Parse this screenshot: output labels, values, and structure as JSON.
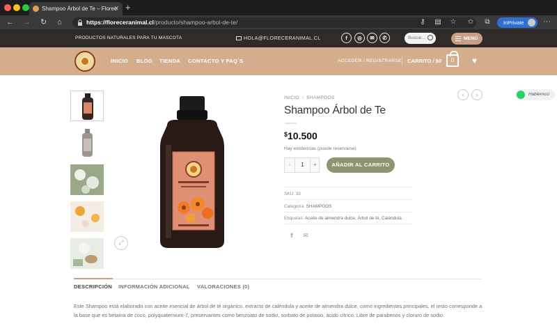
{
  "browser": {
    "tab_title": "Shampoo Árbol de Te – Florec",
    "tab_close": "✕",
    "new_tab": "+",
    "url_host": "https://floreceranimal.cl",
    "url_path": "/producto/shampoo-arbol-de-te/",
    "inprivate_label": "InPrivate",
    "traffic_lights": [
      "#ff5f57",
      "#febc2e",
      "#28c840"
    ]
  },
  "topbar": {
    "tagline": "PRODUCTOS NATURALES PARA TU MASCOTA",
    "email": "HOLA@FLORECERANIMAL.CL",
    "search_placeholder": "Buscar...",
    "menu_label": "MENÚ",
    "social": [
      {
        "name": "facebook-icon",
        "glyph": "f"
      },
      {
        "name": "instagram-icon",
        "glyph": "◎"
      },
      {
        "name": "mail-icon",
        "glyph": "✉"
      },
      {
        "name": "phone-icon",
        "glyph": "✆"
      }
    ]
  },
  "header": {
    "nav": [
      "INICIO",
      "BLOG",
      "TIENDA",
      "CONTACTO Y FAQ´S"
    ],
    "login": "ACCEDER / REGISTRARSE",
    "cart_label": "CARRITO / $0",
    "cart_count": "0"
  },
  "product": {
    "breadcrumb": [
      "INICIO",
      "SHAMPOOS"
    ],
    "title": "Shampoo Árbol de Te",
    "price_symbol": "$",
    "price": "10.500",
    "stock": "Hay existencias (puede reservarse)",
    "quantity": "1",
    "add_to_cart": "AÑADIR AL CARRITO",
    "sku_label": "SKU:",
    "sku": "33",
    "category_label": "Categoría:",
    "category": "SHAMPOOS",
    "tags_label": "Etiquetas:",
    "tags": "Aceite de almendra dulce, Árbol de té, Caléndula"
  },
  "whatsapp": {
    "label": "Hablemos!"
  },
  "tabs": [
    "DESCRIPCIÓN",
    "INFORMACIÓN ADICIONAL",
    "VALORACIONES (0)"
  ],
  "description": "Este Shampoo está elaborado con aceite esencial de árbol de té orgánico, extracto de caléndula y aceite de almendra dulce, como ingredientes principales, el resto corresponde a la base que es betaína de coco, polyquaternium-7, preservantes como benzoato de sodio, sorbato de potasio, ácido cítrico. Libre de parabenos y cloruro de sodio.",
  "colors": {
    "header_bg": "#d3ad8c",
    "topbar_bg": "#2e2b29",
    "accent": "#c7a083",
    "add_to_cart_bg": "#8f9372"
  }
}
